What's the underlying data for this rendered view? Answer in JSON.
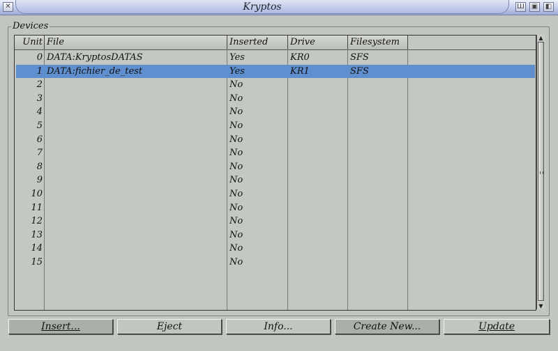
{
  "window": {
    "title": "Kryptos",
    "icons": [
      "close-icon",
      "iconify-icon",
      "zoom-icon",
      "depth-icon"
    ]
  },
  "group": {
    "label": "Devices"
  },
  "columns": {
    "unit": "Unit",
    "file": "File",
    "inserted": "Inserted",
    "drive": "Drive",
    "filesystem": "Filesystem"
  },
  "rows": [
    {
      "unit": "0",
      "file": "DATA:KryptosDATAS",
      "inserted": "Yes",
      "drive": "KR0",
      "filesystem": "SFS"
    },
    {
      "unit": "1",
      "file": "DATA:fichier_de_test",
      "inserted": "Yes",
      "drive": "KR1",
      "filesystem": "SFS",
      "selected": true
    },
    {
      "unit": "2",
      "file": "",
      "inserted": "No",
      "drive": "",
      "filesystem": ""
    },
    {
      "unit": "3",
      "file": "",
      "inserted": "No",
      "drive": "",
      "filesystem": ""
    },
    {
      "unit": "4",
      "file": "",
      "inserted": "No",
      "drive": "",
      "filesystem": ""
    },
    {
      "unit": "5",
      "file": "",
      "inserted": "No",
      "drive": "",
      "filesystem": ""
    },
    {
      "unit": "6",
      "file": "",
      "inserted": "No",
      "drive": "",
      "filesystem": ""
    },
    {
      "unit": "7",
      "file": "",
      "inserted": "No",
      "drive": "",
      "filesystem": ""
    },
    {
      "unit": "8",
      "file": "",
      "inserted": "No",
      "drive": "",
      "filesystem": ""
    },
    {
      "unit": "9",
      "file": "",
      "inserted": "No",
      "drive": "",
      "filesystem": ""
    },
    {
      "unit": "10",
      "file": "",
      "inserted": "No",
      "drive": "",
      "filesystem": ""
    },
    {
      "unit": "11",
      "file": "",
      "inserted": "No",
      "drive": "",
      "filesystem": ""
    },
    {
      "unit": "12",
      "file": "",
      "inserted": "No",
      "drive": "",
      "filesystem": ""
    },
    {
      "unit": "13",
      "file": "",
      "inserted": "No",
      "drive": "",
      "filesystem": ""
    },
    {
      "unit": "14",
      "file": "",
      "inserted": "No",
      "drive": "",
      "filesystem": ""
    },
    {
      "unit": "15",
      "file": "",
      "inserted": "No",
      "drive": "",
      "filesystem": ""
    }
  ],
  "buttons": {
    "insert": "Insert...",
    "eject": "Eject",
    "info": "Info...",
    "create_new": "Create New...",
    "update": "Update"
  },
  "colors": {
    "selection": "#5f8fcf",
    "window_bg": "#c2c6c1",
    "title_bar": "#c9d2ee"
  }
}
